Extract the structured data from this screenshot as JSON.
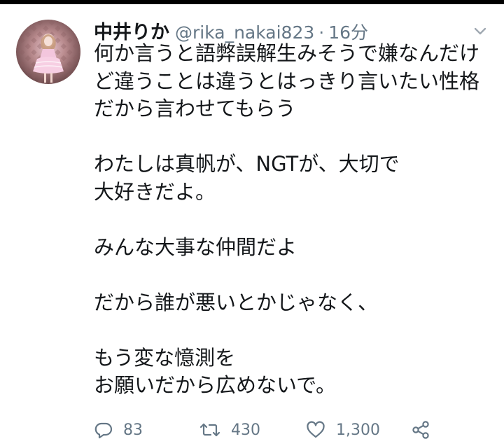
{
  "tweet": {
    "author_name": "中井りか",
    "handle": "@rika_nakai823",
    "separator": "·",
    "time": "16分",
    "paragraphs": [
      [
        "何か言うと語弊誤解生みそうで嫌なんだけ",
        "ど違うことは違うとはっきり言いたい性格",
        "だから言わせてもらう"
      ],
      [
        "わたしは真帆が、NGTが、大切で",
        "大好きだよ。"
      ],
      [
        "みんな大事な仲間だよ"
      ],
      [
        "だから誰が悪いとかじゃなく、"
      ],
      [
        "もう変な憶測を",
        "お願いだから広めないで。"
      ]
    ],
    "actions": {
      "reply_count": "83",
      "retweet_count": "430",
      "like_count": "1,300"
    }
  },
  "icons": {
    "menu": "chevron-down-icon",
    "reply": "reply-icon",
    "retweet": "retweet-icon",
    "like": "heart-icon",
    "share": "share-icon"
  },
  "colors": {
    "text": "#14171a",
    "secondary": "#657786",
    "background": "#ffffff"
  }
}
